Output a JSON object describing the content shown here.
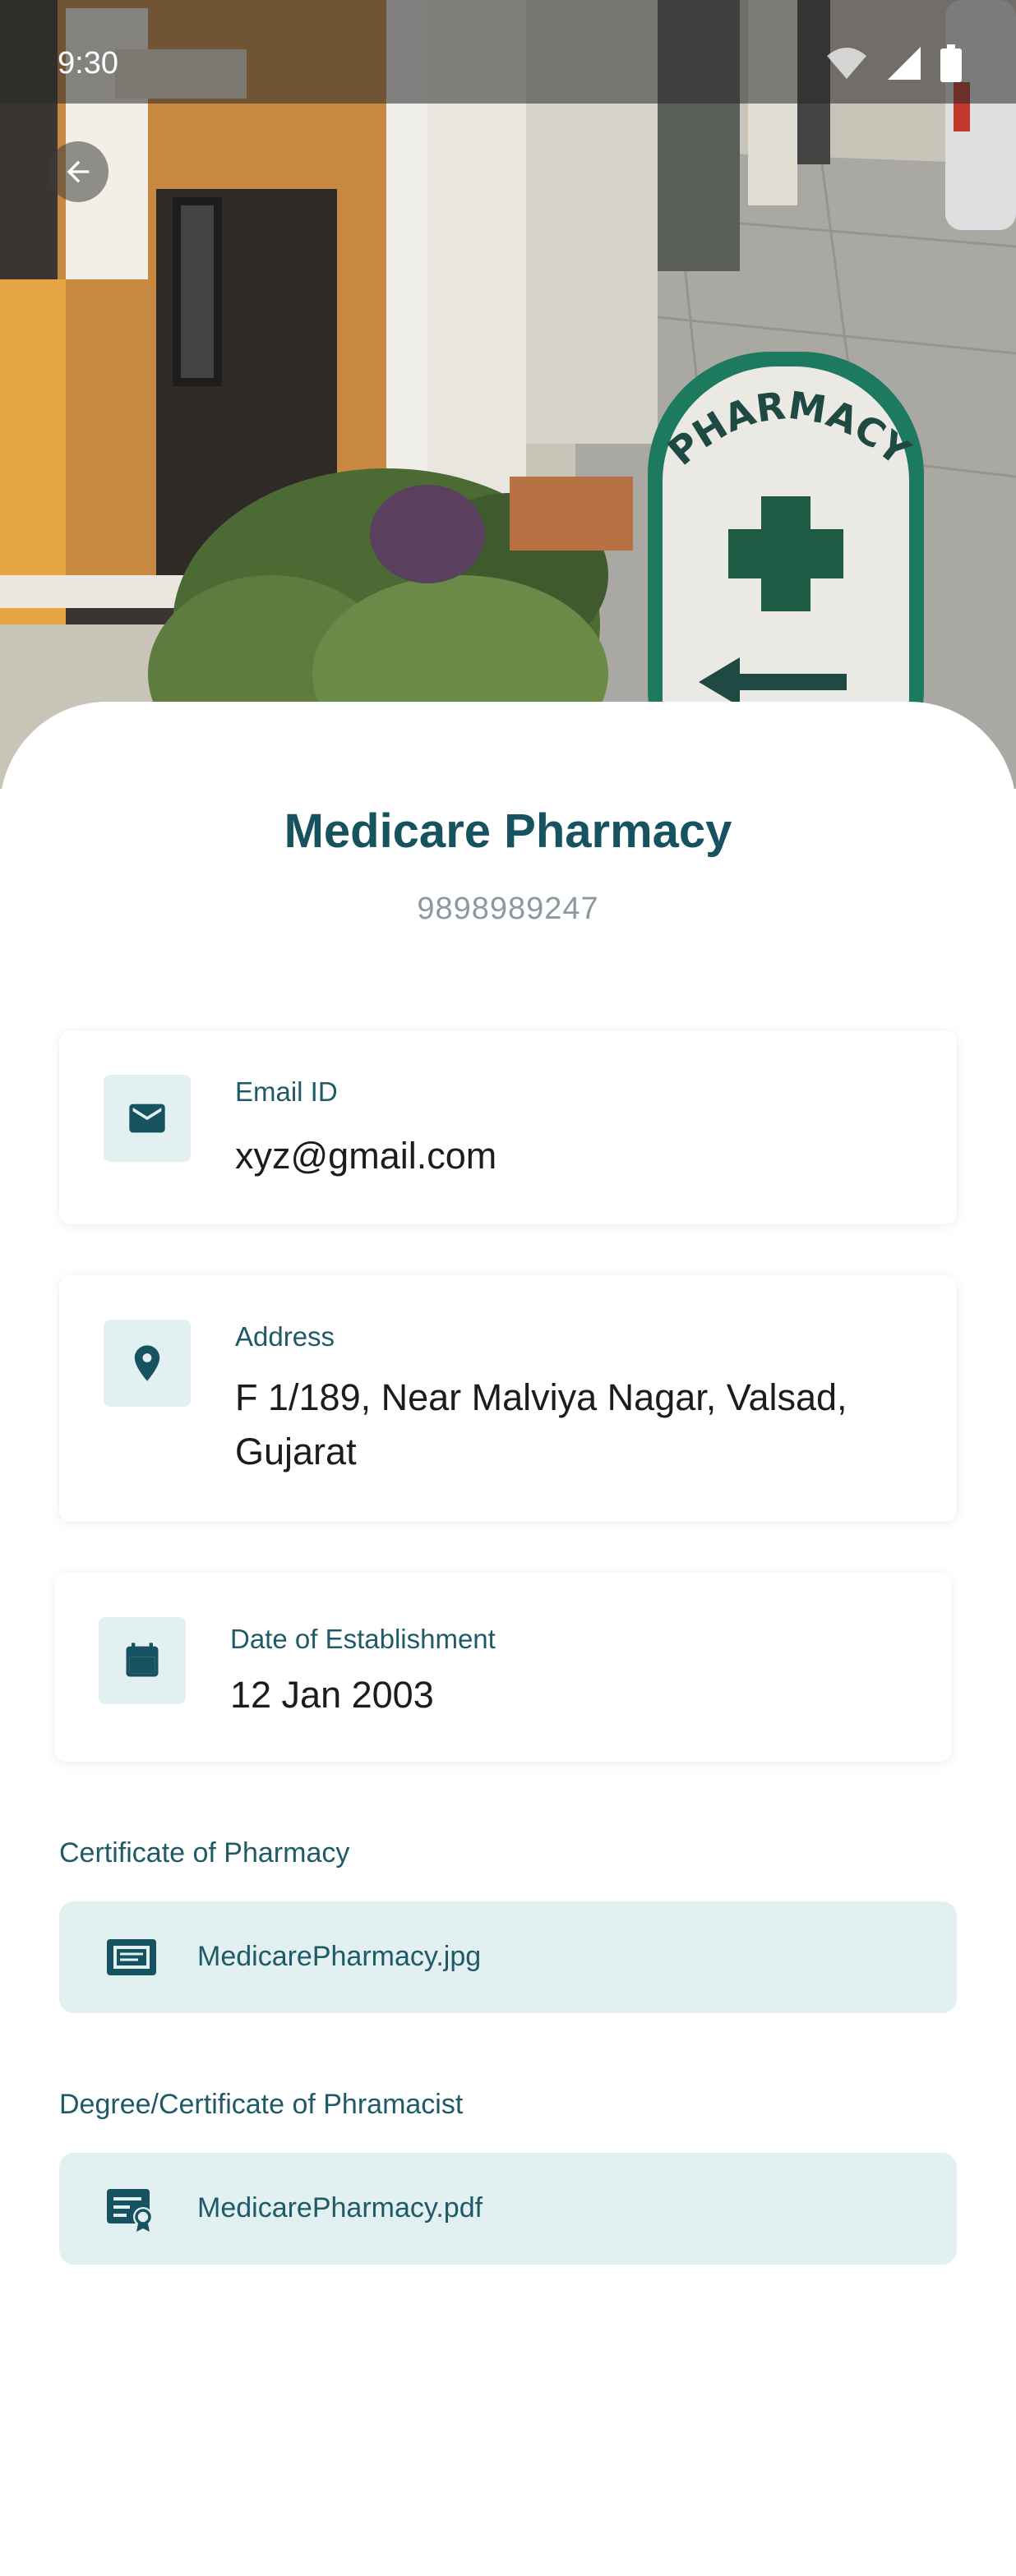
{
  "status_bar": {
    "time": "9:30"
  },
  "pharmacy": {
    "name": "Medicare Pharmacy",
    "phone": "9898989247"
  },
  "details": {
    "email": {
      "label": "Email ID",
      "value": "xyz@gmail.com",
      "icon": "mail-icon"
    },
    "address": {
      "label": "Address",
      "value_line1": "F 1/189, Near Malviya Nagar, Valsad,",
      "value_line2": "Gujarat",
      "icon": "location-pin-icon"
    },
    "established": {
      "label": "Date of Establishment",
      "value": "12 Jan 2003",
      "icon": "calendar-icon"
    }
  },
  "documents": {
    "pharmacy_certificate": {
      "label": "Certificate of Pharmacy",
      "file": "MedicarePharmacy.jpg",
      "icon": "image-file-icon"
    },
    "pharmacist_degree": {
      "label": "Degree/Certificate of Phramacist",
      "file": "MedicarePharmacy.pdf",
      "icon": "certificate-icon"
    }
  },
  "hero": {
    "sign_text": "PHARMACY"
  },
  "colors": {
    "primary": "#16525f",
    "icon_bg": "#e3f0f1",
    "text": "#1c1c1c",
    "muted": "#8b9aa0"
  }
}
